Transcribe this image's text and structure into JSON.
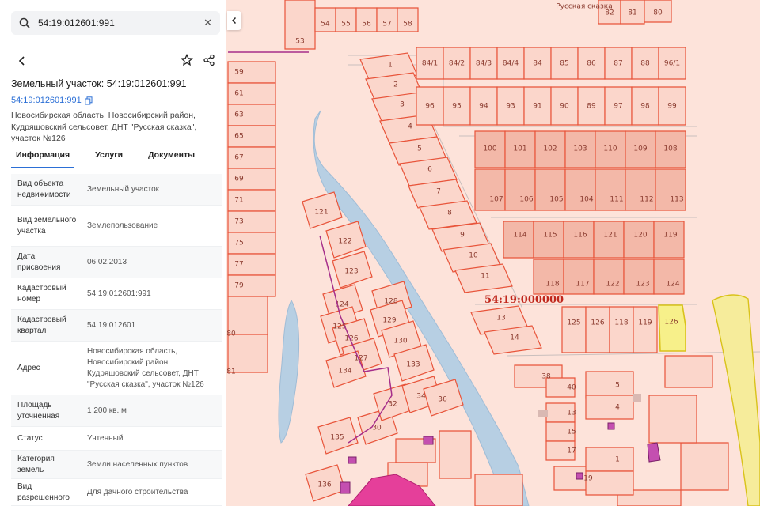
{
  "search": {
    "value": "54:19:012601:991",
    "clear_icon": "close-icon",
    "icon": "search-icon"
  },
  "toolbar": {
    "back_icon": "chevron-left-icon",
    "favorite_icon": "star-icon",
    "share_icon": "share-icon"
  },
  "parcel": {
    "title": "Земельный участок: 54:19:012601:991",
    "cad_number": "54:19:012601:991",
    "address": "Новосибирская область, Новосибирский район, Кудряшовский сельсовет, ДНТ \"Русская сказка\", участок №126"
  },
  "tabs": [
    "Информация",
    "Услуги",
    "Документы"
  ],
  "info": [
    {
      "k": "Вид объекта недвижимости",
      "v": "Земельный участок"
    },
    {
      "k": "Вид земельного участка",
      "v": "Землепользование"
    },
    {
      "k": "Дата присвоения",
      "v": "06.02.2013"
    },
    {
      "k": "Кадастровый номер",
      "v": "54:19:012601:991"
    },
    {
      "k": "Кадастровый квартал",
      "v": "54:19:012601"
    },
    {
      "k": "Адрес",
      "v": "Новосибирская область, Новосибирский район, Кудряшовский сельсовет, ДНТ \"Русская сказка\", участок №126"
    },
    {
      "k": "Площадь уточненная",
      "v": "1 200 кв. м"
    },
    {
      "k": "Статус",
      "v": "Учтенный"
    },
    {
      "k": "Категория земель",
      "v": "Земли населенных пунктов"
    },
    {
      "k": "Вид разрешенного",
      "v": "Для дачного строительства"
    }
  ],
  "map": {
    "quarter_label": "54:19:000000",
    "top_label": "Русская сказка",
    "plot_labels": [
      "53",
      "54",
      "55",
      "56",
      "57",
      "58",
      "82",
      "81",
      "80",
      "59",
      "61",
      "63",
      "65",
      "67",
      "69",
      "71",
      "73",
      "75",
      "77",
      "79",
      "80",
      "81",
      "1",
      "2",
      "3",
      "4",
      "5",
      "6",
      "7",
      "8",
      "9",
      "10",
      "11",
      "13",
      "14",
      "84/1",
      "84/2",
      "84/3",
      "84/4",
      "84",
      "85",
      "86",
      "87",
      "88",
      "96/1",
      "96",
      "95",
      "94",
      "93",
      "91",
      "90",
      "89",
      "97",
      "98",
      "99",
      "100",
      "101",
      "102",
      "103",
      "110",
      "109",
      "108",
      "107",
      "106",
      "105",
      "104",
      "111",
      "112",
      "113",
      "114",
      "115",
      "116",
      "121",
      "120",
      "119",
      "118",
      "117",
      "122",
      "123",
      "124",
      "125",
      "126",
      "118",
      "119",
      "120",
      "121",
      "122",
      "123",
      "124",
      "125",
      "126",
      "127",
      "128",
      "129",
      "130",
      "133",
      "134",
      "135",
      "136",
      "30",
      "32",
      "34",
      "36",
      "38",
      "40",
      "13",
      "15",
      "17",
      "19",
      "5",
      "4",
      "1"
    ],
    "colors": {
      "plot": "#fbd6cb",
      "plot_border": "#e8543a",
      "selected": "#f7f08a",
      "water": "#b7cfe3"
    }
  },
  "collapse_icon": "chevron-left-icon"
}
